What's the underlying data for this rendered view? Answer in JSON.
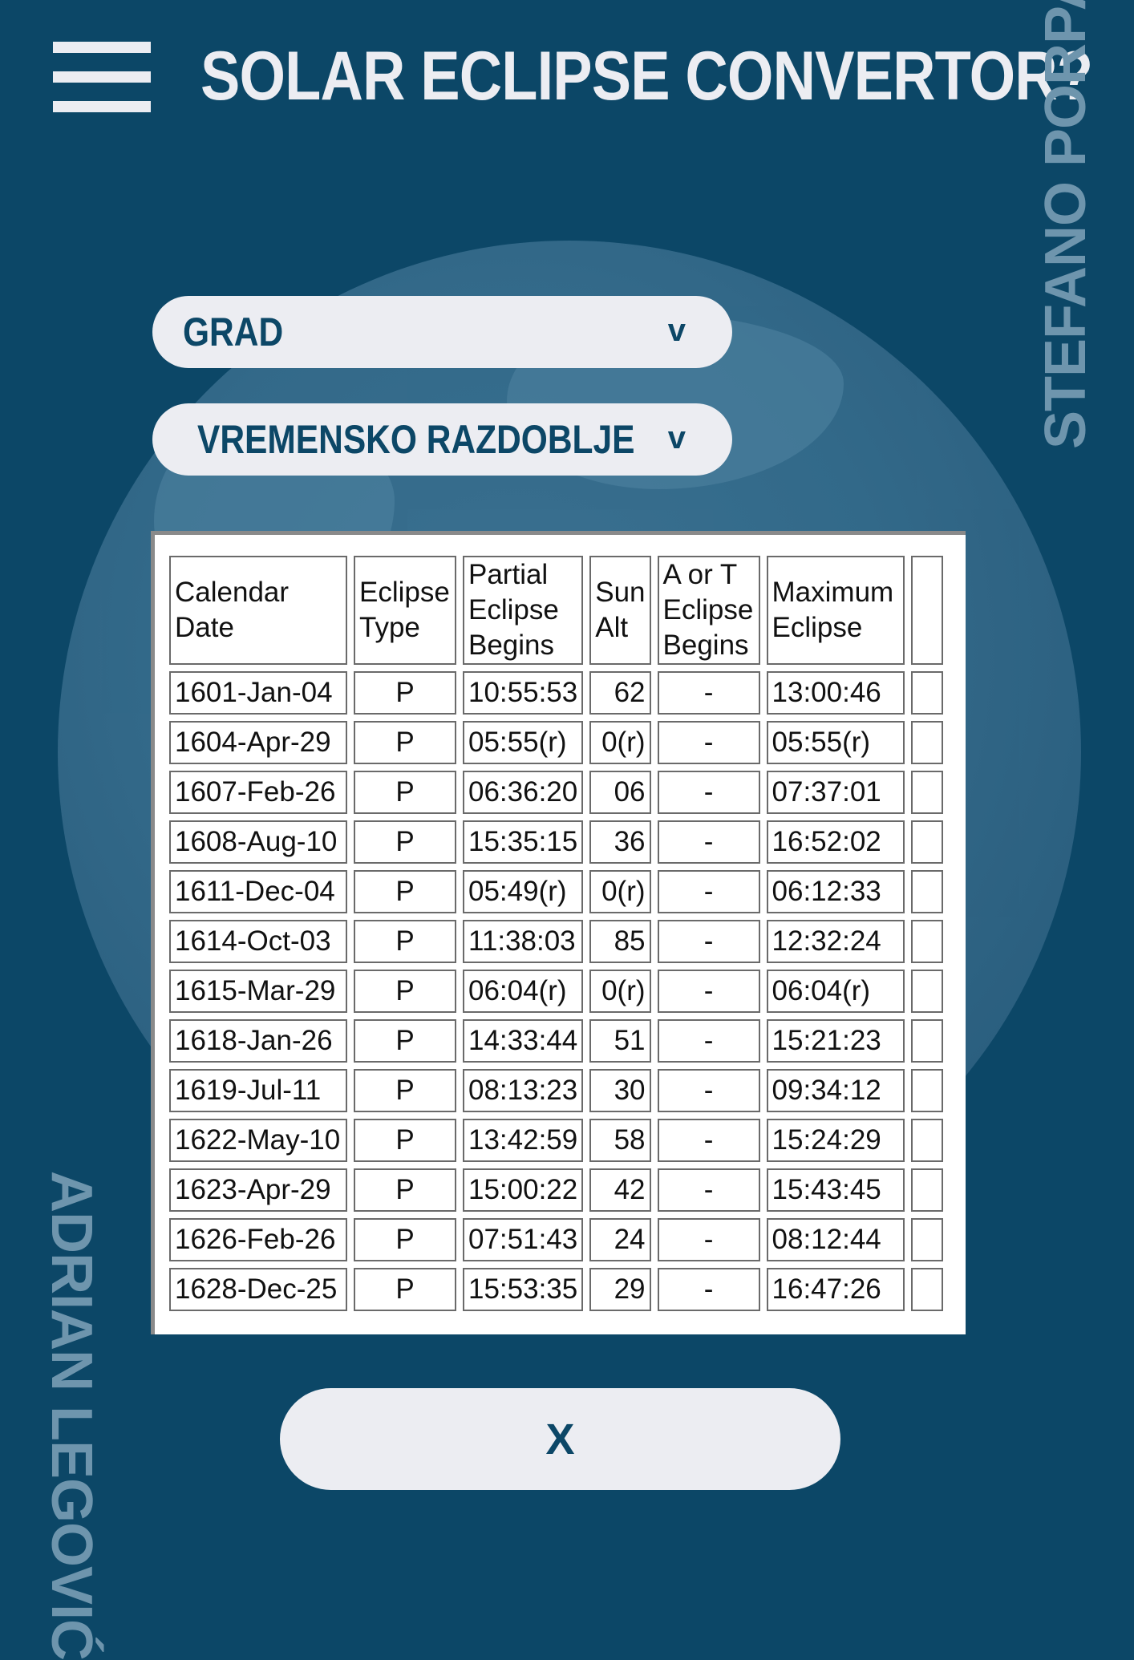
{
  "header": {
    "title": "SOLAR ECLIPSE CONVERTOR?",
    "menu_icon": "hamburger-icon"
  },
  "credits": {
    "right_vertical": "STEFANO PORPAT",
    "left_vertical": "ADRIAN LEGOVIĆ"
  },
  "filters": {
    "city": {
      "label": "GRAD",
      "chevron": "v"
    },
    "period": {
      "label": "VREMENSKO RAZDOBLJE",
      "chevron": "v"
    }
  },
  "table": {
    "headers": {
      "calendar_date": "Calendar Date",
      "eclipse_type": "Eclipse Type",
      "partial_begins": "Partial Eclipse Begins",
      "sun_alt": "Sun Alt",
      "at_begins": "A or T Eclipse Begins",
      "maximum": "Maximum Eclipse"
    },
    "rows": [
      {
        "date": "1601-Jan-04",
        "type": "P",
        "partial": "10:55:53",
        "alt": "62",
        "at": "-",
        "max": "13:00:46"
      },
      {
        "date": "1604-Apr-29",
        "type": "P",
        "partial": "05:55(r)",
        "alt": "0(r)",
        "at": "-",
        "max": "05:55(r)"
      },
      {
        "date": "1607-Feb-26",
        "type": "P",
        "partial": "06:36:20",
        "alt": "06",
        "at": "-",
        "max": "07:37:01"
      },
      {
        "date": "1608-Aug-10",
        "type": "P",
        "partial": "15:35:15",
        "alt": "36",
        "at": "-",
        "max": "16:52:02"
      },
      {
        "date": "1611-Dec-04",
        "type": "P",
        "partial": "05:49(r)",
        "alt": "0(r)",
        "at": "-",
        "max": "06:12:33"
      },
      {
        "date": "1614-Oct-03",
        "type": "P",
        "partial": "11:38:03",
        "alt": "85",
        "at": "-",
        "max": "12:32:24"
      },
      {
        "date": "1615-Mar-29",
        "type": "P",
        "partial": "06:04(r)",
        "alt": "0(r)",
        "at": "-",
        "max": "06:04(r)"
      },
      {
        "date": "1618-Jan-26",
        "type": "P",
        "partial": "14:33:44",
        "alt": "51",
        "at": "-",
        "max": "15:21:23"
      },
      {
        "date": "1619-Jul-11",
        "type": "P",
        "partial": "08:13:23",
        "alt": "30",
        "at": "-",
        "max": "09:34:12"
      },
      {
        "date": "1622-May-10",
        "type": "P",
        "partial": "13:42:59",
        "alt": "58",
        "at": "-",
        "max": "15:24:29"
      },
      {
        "date": "1623-Apr-29",
        "type": "P",
        "partial": "15:00:22",
        "alt": "42",
        "at": "-",
        "max": "15:43:45"
      },
      {
        "date": "1626-Feb-26",
        "type": "P",
        "partial": "07:51:43",
        "alt": "24",
        "at": "-",
        "max": "08:12:44"
      },
      {
        "date": "1628-Dec-25",
        "type": "P",
        "partial": "15:53:35",
        "alt": "29",
        "at": "-",
        "max": "16:47:26"
      }
    ]
  },
  "close_button": {
    "label": "X"
  },
  "colors": {
    "background": "#0c4767",
    "pill": "#ecedf2",
    "accent_text": "#6e95ad",
    "globe": "#356b8b"
  }
}
